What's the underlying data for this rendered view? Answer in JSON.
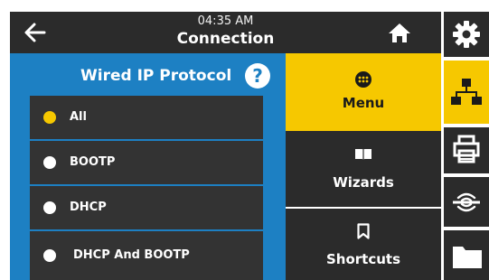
{
  "header": {
    "time": "04:35 AM",
    "title": "Connection"
  },
  "panel": {
    "title": "Wired IP Protocol",
    "help_label": "?",
    "options": [
      {
        "label": "All",
        "selected": true
      },
      {
        "label": "BOOTP",
        "selected": false
      },
      {
        "label": "DHCP",
        "selected": false
      },
      {
        "label": "DHCP And BOOTP",
        "selected": false
      }
    ]
  },
  "menu": {
    "items": [
      {
        "label": "Menu",
        "icon": "grid-dots-icon",
        "active": true
      },
      {
        "label": "Wizards",
        "icon": "book-icon",
        "active": false
      },
      {
        "label": "Shortcuts",
        "icon": "bookmark-icon",
        "active": false
      }
    ]
  },
  "sidebar": {
    "items": [
      {
        "icon": "gear-icon",
        "active": false
      },
      {
        "icon": "network-icon",
        "active": true
      },
      {
        "icon": "printer-icon",
        "active": false
      },
      {
        "icon": "rfid-icon",
        "active": false
      },
      {
        "icon": "folder-icon",
        "active": false
      }
    ]
  },
  "colors": {
    "accent": "#f6c800",
    "panel_blue": "#1d80c3",
    "dark": "#2b2b2b",
    "list_bg": "#333333"
  }
}
